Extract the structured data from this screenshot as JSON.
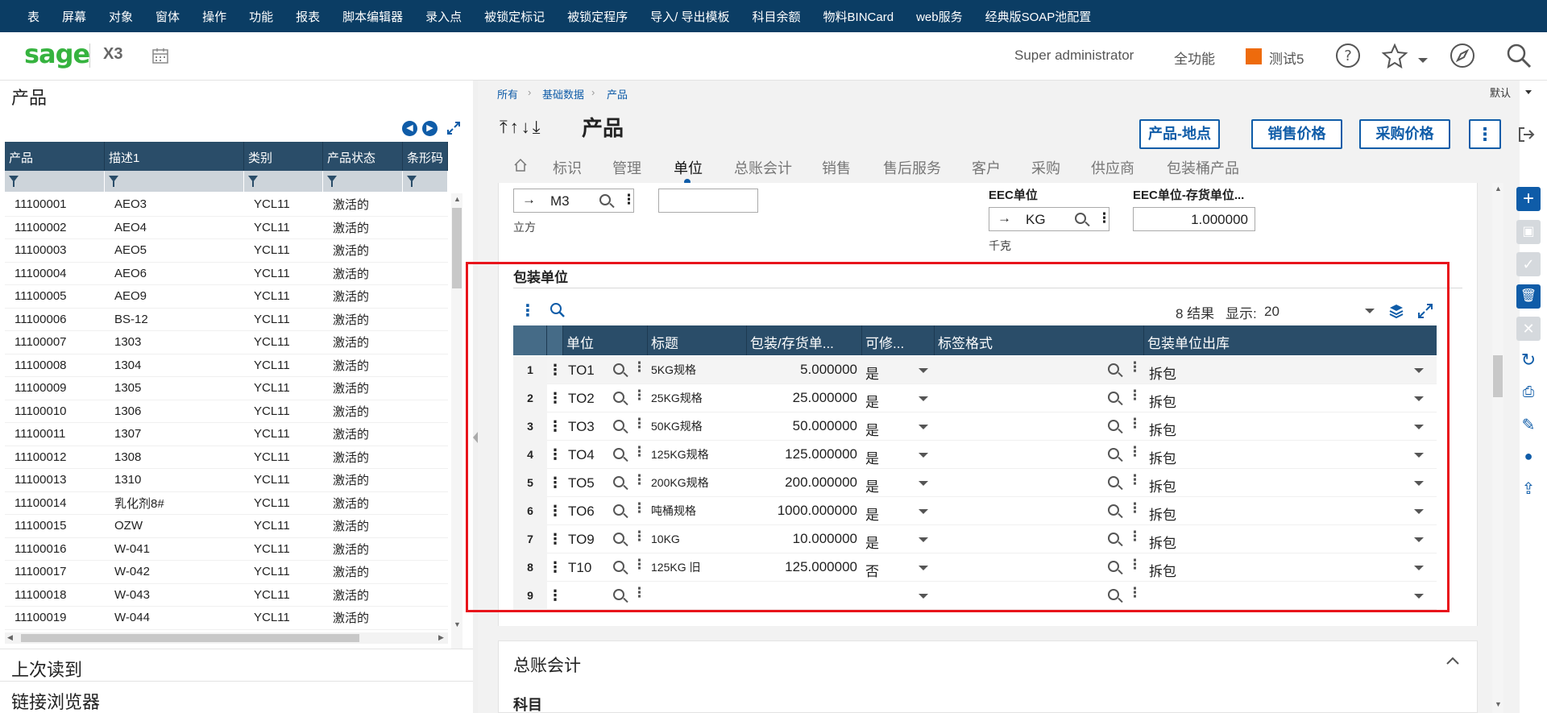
{
  "menu": [
    "表",
    "屏幕",
    "对象",
    "窗体",
    "操作",
    "功能",
    "报表",
    "脚本编辑器",
    "录入点",
    "被锁定标记",
    "被锁定程序",
    "导入/ 导出模板",
    "科目余额",
    "物料BINCard",
    "web服务",
    "经典版SOAP池配置"
  ],
  "header": {
    "logo": "sage",
    "product": "X3",
    "user": "Super administrator",
    "mode": "全功能",
    "folder": "测试5",
    "folder_color": "#ee6b0c"
  },
  "left": {
    "title": "产品",
    "columns": [
      "产品",
      "描述1",
      "类别",
      "产品状态",
      "条形码"
    ],
    "rows": [
      [
        "11100001",
        "AEO3",
        "YCL11",
        "激活的"
      ],
      [
        "11100002",
        "AEO4",
        "YCL11",
        "激活的"
      ],
      [
        "11100003",
        "AEO5",
        "YCL11",
        "激活的"
      ],
      [
        "11100004",
        "AEO6",
        "YCL11",
        "激活的"
      ],
      [
        "11100005",
        "AEO9",
        "YCL11",
        "激活的"
      ],
      [
        "11100006",
        "BS-12",
        "YCL11",
        "激活的"
      ],
      [
        "11100007",
        "1303",
        "YCL11",
        "激活的"
      ],
      [
        "11100008",
        "1304",
        "YCL11",
        "激活的"
      ],
      [
        "11100009",
        "1305",
        "YCL11",
        "激活的"
      ],
      [
        "11100010",
        "1306",
        "YCL11",
        "激活的"
      ],
      [
        "11100011",
        "1307",
        "YCL11",
        "激活的"
      ],
      [
        "11100012",
        "1308",
        "YCL11",
        "激活的"
      ],
      [
        "11100013",
        "1310",
        "YCL11",
        "激活的"
      ],
      [
        "11100014",
        "乳化剂8#",
        "YCL11",
        "激活的"
      ],
      [
        "11100015",
        "OZW",
        "YCL11",
        "激活的"
      ],
      [
        "11100016",
        "W-041",
        "YCL11",
        "激活的"
      ],
      [
        "11100017",
        "W-042",
        "YCL11",
        "激活的"
      ],
      [
        "11100018",
        "W-043",
        "YCL11",
        "激活的"
      ],
      [
        "11100019",
        "W-044",
        "YCL11",
        "激活的"
      ]
    ],
    "last_read": "上次读到",
    "link_browser": "链接浏览器"
  },
  "breadcrumb": [
    "所有",
    "基础数据",
    "产品"
  ],
  "default_label": "默认",
  "page_title": "产品",
  "buttons": {
    "location": "产品-地点",
    "sales_price": "销售价格",
    "purchase_price": "采购价格"
  },
  "tabs": [
    "标识",
    "管理",
    "单位",
    "总账会计",
    "销售",
    "售后服务",
    "客户",
    "采购",
    "供应商",
    "包装桶产品"
  ],
  "active_tab": "单位",
  "unit_fields": {
    "unit_code": "M3",
    "unit_desc": "立方",
    "eec_label": "EEC单位",
    "eec_code": "KG",
    "eec_desc": "千克",
    "eec_factor_label": "EEC单位-存货单位...",
    "eec_factor": "1.000000"
  },
  "pack_section": {
    "title": "包装单位",
    "result_text": "8 结果",
    "display_label": "显示:",
    "display_value": "20",
    "columns": [
      "单位",
      "标题",
      "包装/存货单...",
      "可修...",
      "标签格式",
      "包装单位出库"
    ],
    "rows": [
      {
        "n": "1",
        "unit": "TO1",
        "title": "5KG规格",
        "qty": "5.000000",
        "mod": "是",
        "out": "拆包"
      },
      {
        "n": "2",
        "unit": "TO2",
        "title": "25KG规格",
        "qty": "25.000000",
        "mod": "是",
        "out": "拆包"
      },
      {
        "n": "3",
        "unit": "TO3",
        "title": "50KG规格",
        "qty": "50.000000",
        "mod": "是",
        "out": "拆包"
      },
      {
        "n": "4",
        "unit": "TO4",
        "title": "125KG规格",
        "qty": "125.000000",
        "mod": "是",
        "out": "拆包"
      },
      {
        "n": "5",
        "unit": "TO5",
        "title": "200KG规格",
        "qty": "200.000000",
        "mod": "是",
        "out": "拆包"
      },
      {
        "n": "6",
        "unit": "TO6",
        "title": "吨桶规格",
        "qty": "1000.000000",
        "mod": "是",
        "out": "拆包"
      },
      {
        "n": "7",
        "unit": "TO9",
        "title": "10KG",
        "qty": "10.000000",
        "mod": "是",
        "out": "拆包"
      },
      {
        "n": "8",
        "unit": "T10",
        "title": "125KG 旧",
        "qty": "125.000000",
        "mod": "否",
        "out": "拆包"
      },
      {
        "n": "9",
        "unit": "",
        "title": "",
        "qty": "",
        "mod": "",
        "out": ""
      }
    ]
  },
  "gl_section": {
    "title": "总账会计",
    "subtitle": "科目"
  }
}
